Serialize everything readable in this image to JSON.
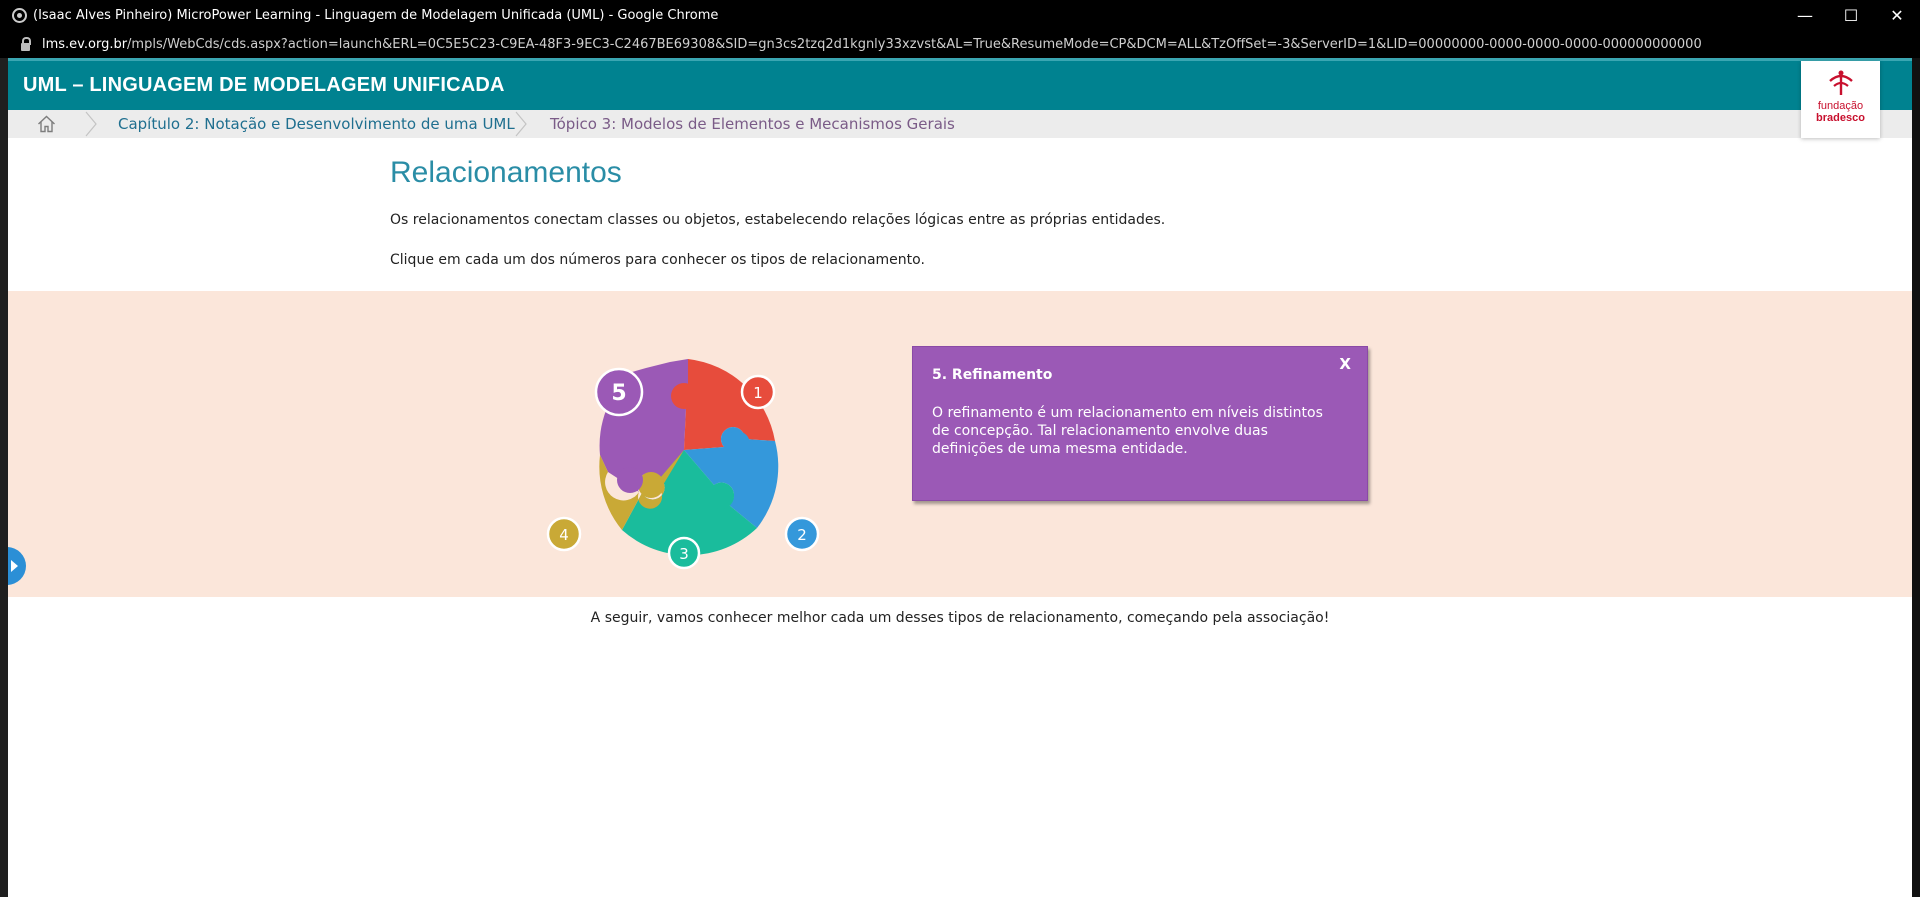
{
  "window": {
    "title": "(Isaac Alves Pinheiro) MicroPower Learning - Linguagem de Modelagem Unificada (UML) - Google Chrome",
    "controls": {
      "minimize": "—",
      "maximize": "☐",
      "close": "✕"
    }
  },
  "address": {
    "host": "lms.ev.org.br",
    "path": "/mpls/WebCds/cds.aspx?action=launch&ERL=0C5E5C23-C9EA-48F3-9EC3-C2467BE69308&SID=gn3cs2tzq2d1kgnly33xzvst&AL=True&ResumeMode=CP&DCM=ALL&TzOffSet=-3&ServerID=1&LID=00000000-0000-0000-0000-000000000000"
  },
  "header": {
    "title": "UML – LINGUAGEM DE MODELAGEM UNIFICADA",
    "logo_line1": "fundação",
    "logo_line2": "bradesco",
    "color": "#008290"
  },
  "breadcrumb": {
    "home_icon": "home-icon",
    "items": [
      "Capítulo 2: Notação e Desenvolvimento de uma UML",
      "Tópico 3: Modelos de Elementos e Mecanismos Gerais"
    ]
  },
  "content": {
    "title": "Relacionamentos",
    "para1": "Os relacionamentos conectam classes ou objetos, estabelecendo relações lógicas entre as próprias entidades.",
    "para2": "Clique em cada um dos números para conhecer os tipos de relacionamento."
  },
  "puzzle": {
    "pieces": [
      {
        "number": "1",
        "color": "#e74c3c"
      },
      {
        "number": "2",
        "color": "#3498db"
      },
      {
        "number": "3",
        "color": "#1abc9c"
      },
      {
        "number": "4",
        "color": "#c9a936"
      },
      {
        "number": "5",
        "color": "#9b59b6",
        "selected": true
      }
    ]
  },
  "popup": {
    "close_label": "X",
    "title": "5. Refinamento",
    "body": "O refinamento é um relacionamento em níveis distintos de concepção. Tal relacionamento envolve duas definições de uma mesma entidade."
  },
  "bottom_text": "A seguir, vamos conhecer melhor cada um desses tipos de relacionamento, começando pela associação!"
}
